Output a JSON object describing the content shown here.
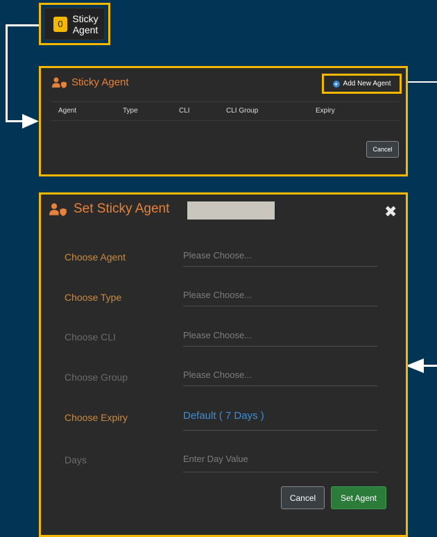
{
  "badge": {
    "count": "0",
    "label": "Sticky Agent"
  },
  "list_panel": {
    "title": "Sticky Agent",
    "add_button": "Add New Agent",
    "columns": [
      "Agent",
      "Type",
      "CLI",
      "CLI Group",
      "Expiry"
    ],
    "cancel": "Cancel"
  },
  "dialog": {
    "title": "Set Sticky Agent",
    "close": "✖",
    "rows": [
      {
        "label": "Choose Agent",
        "value": "Please Choose..."
      },
      {
        "label": "Choose Type",
        "value": "Please Choose..."
      },
      {
        "label": "Choose CLI",
        "value": "Please Choose..."
      },
      {
        "label": "Choose Group",
        "value": "Please Choose..."
      },
      {
        "label": "Choose Expiry",
        "value": "Default ( 7 Days )"
      },
      {
        "label": "Days",
        "placeholder": "Enter Day Value"
      }
    ],
    "cancel": "Cancel",
    "submit": "Set Agent"
  },
  "colors": {
    "background": "#023456",
    "highlight": "#f5b800",
    "panel": "#2a2a2a",
    "title_orange": "#e6823a",
    "field_blue": "#3b8ed6",
    "submit_green": "#2b7c3a"
  },
  "icons": [
    "user-shield-icon",
    "plus-circle-icon",
    "close-icon",
    "arrow-right-icon",
    "arrow-left-icon"
  ]
}
